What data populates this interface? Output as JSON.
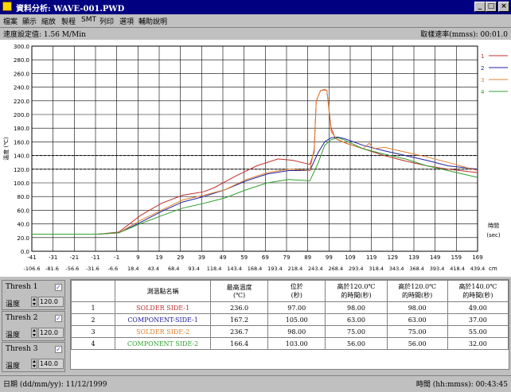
{
  "window": {
    "title": "資料分析: WAVE-001.PWD",
    "buttons": [
      "_",
      "□",
      "×"
    ]
  },
  "menu": [
    "檔案",
    "顯示",
    "縮放",
    "製程",
    "SMT",
    "列印",
    "選項",
    "輔助說明"
  ],
  "info": {
    "speed": "速度設定值: 1.56 M/Min",
    "sample_rate": "取樣速率(mmss): 00:01.0"
  },
  "colors": {
    "series1": "#c03030",
    "series2": "#2020a0",
    "series3": "#e08030",
    "series4": "#30a030",
    "titlebar": "#000080"
  },
  "chart_data": {
    "type": "line",
    "ylabel": "溫度 (℃)",
    "xlabel_time": "時間",
    "xlabel_time_unit": "(sec)",
    "xlabel_dist_unit": "cm",
    "ylim": [
      0,
      300
    ],
    "yticks": [
      "0.0",
      "20.0",
      "40.0",
      "60.0",
      "80.0",
      "100.0",
      "120.0",
      "140.0",
      "160.0",
      "180.0",
      "200.0",
      "220.0",
      "240.0",
      "260.0",
      "280.0",
      "300.0"
    ],
    "time_ticks": [
      "-41",
      "-31",
      "-21",
      "-11",
      "-1",
      "9",
      "19",
      "29",
      "39",
      "49",
      "59",
      "69",
      "79",
      "89",
      "99",
      "109",
      "119",
      "129",
      "139",
      "149",
      "159",
      "169"
    ],
    "dist_ticks": [
      "-106.6",
      "-81.6",
      "-56.6",
      "-31.6",
      "-6.6",
      "18.4",
      "43.4",
      "68.4",
      "93.4",
      "118.4",
      "143.4",
      "168.4",
      "193.4",
      "218.4",
      "243.4",
      "268.4",
      "293.4",
      "318.4",
      "343.4",
      "368.4",
      "393.4",
      "418.4",
      "439.4"
    ],
    "xlim": [
      -41,
      169
    ],
    "threshold_lines": [
      120,
      140
    ],
    "legend": [
      "1",
      "2",
      "3",
      "4"
    ],
    "series": [
      {
        "name": "1",
        "x": [
          -41,
          -10,
          0,
          10,
          20,
          30,
          40,
          45,
          55,
          65,
          75,
          82,
          90,
          92,
          93,
          95,
          97,
          98,
          100,
          102,
          107,
          115,
          125,
          135,
          145,
          155,
          169
        ],
        "y": [
          25,
          25,
          28,
          52,
          70,
          82,
          87,
          93,
          110,
          125,
          135,
          133,
          127,
          145,
          220,
          235,
          236,
          235,
          180,
          165,
          158,
          150,
          140,
          132,
          125,
          120,
          115
        ]
      },
      {
        "name": "2",
        "x": [
          -41,
          -10,
          0,
          10,
          20,
          30,
          40,
          50,
          60,
          70,
          80,
          90,
          94,
          97,
          100,
          103,
          106,
          115,
          125,
          135,
          145,
          155,
          169
        ],
        "y": [
          25,
          25,
          27,
          42,
          58,
          72,
          80,
          90,
          103,
          113,
          118,
          118,
          145,
          160,
          166,
          167,
          165,
          155,
          147,
          140,
          133,
          125,
          120
        ]
      },
      {
        "name": "3",
        "x": [
          -41,
          -10,
          0,
          10,
          20,
          30,
          40,
          50,
          60,
          70,
          80,
          90,
          92,
          93,
          95,
          97,
          98,
          100,
          103,
          110,
          115,
          118,
          120,
          125,
          135,
          145,
          155,
          169
        ],
        "y": [
          25,
          25,
          27,
          45,
          60,
          75,
          82,
          90,
          105,
          115,
          120,
          118,
          150,
          220,
          235,
          237,
          235,
          175,
          163,
          155,
          150,
          158,
          150,
          152,
          145,
          138,
          130,
          118
        ]
      },
      {
        "name": "4",
        "x": [
          -41,
          -10,
          0,
          10,
          20,
          30,
          40,
          50,
          60,
          70,
          80,
          90,
          94,
          97,
          100,
          103,
          106,
          115,
          125,
          135,
          145,
          155,
          169
        ],
        "y": [
          25,
          25,
          27,
          40,
          52,
          63,
          70,
          78,
          90,
          100,
          105,
          103,
          130,
          155,
          163,
          166,
          163,
          150,
          142,
          135,
          125,
          118,
          108
        ]
      }
    ]
  },
  "thresholds": [
    {
      "label": "Thresh 1",
      "temp_label": "溫度",
      "value": "120.0"
    },
    {
      "label": "Thresh 2",
      "temp_label": "溫度",
      "value": "120.0"
    },
    {
      "label": "Thresh 3",
      "temp_label": "溫度",
      "value": "140.0"
    }
  ],
  "table": {
    "headers": [
      "",
      "測溫點名稱",
      "最高溫度\n(℃)",
      "位於\n(秒)",
      "高於120.0℃\n的時間(秒)",
      "高於120.0℃\n的時間(秒)",
      "高於140.0℃\n的時間(秒)"
    ],
    "rows": [
      [
        "1",
        "SOLDER SIDE-1",
        "236.0",
        "97.00",
        "98.00",
        "98.00",
        "49.00"
      ],
      [
        "2",
        "COMPONENT-SIDE-1",
        "167.2",
        "105.00",
        "63.00",
        "63.00",
        "37.00"
      ],
      [
        "3",
        "SOLDER SIDE-2",
        "236.7",
        "98.00",
        "75.00",
        "75.00",
        "55.00"
      ],
      [
        "4",
        "COMPONENT SIDE-2",
        "166.4",
        "103.00",
        "56.00",
        "56.00",
        "32.00"
      ]
    ]
  },
  "status": {
    "date": "日期 (dd/mm/yy): 11/12/1999",
    "time": "時間 (hh:mmss): 00:43:45"
  }
}
